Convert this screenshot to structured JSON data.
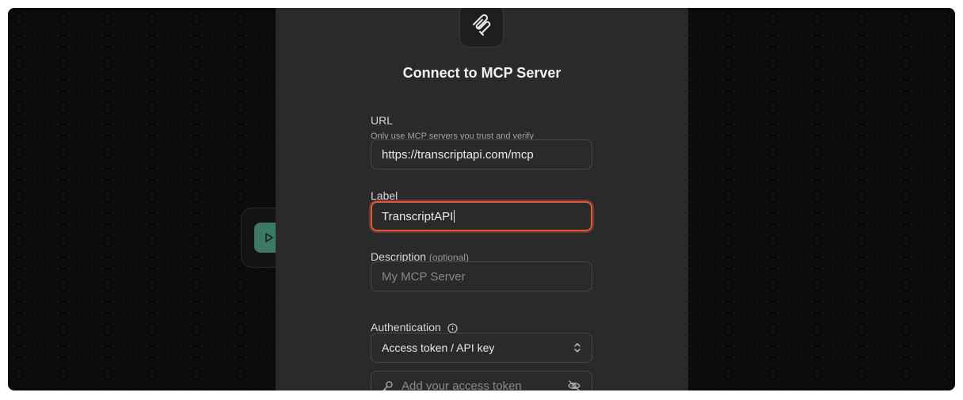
{
  "dialog": {
    "title": "Connect to MCP Server",
    "url": {
      "label": "URL",
      "hint": "Only use MCP servers you trust and verify",
      "value": "https://transcriptapi.com/mcp"
    },
    "label_field": {
      "label": "Label",
      "value": "TranscriptAPI"
    },
    "description": {
      "label": "Description",
      "optional": "(optional)",
      "placeholder": "My MCP Server"
    },
    "authentication": {
      "label": "Authentication",
      "selected": "Access token / API key"
    },
    "token": {
      "placeholder": "Add your access token"
    }
  },
  "colors": {
    "accent_focus": "#e0583a",
    "modal_bg": "#2a2a2a",
    "node_green": "#3d7a66"
  }
}
